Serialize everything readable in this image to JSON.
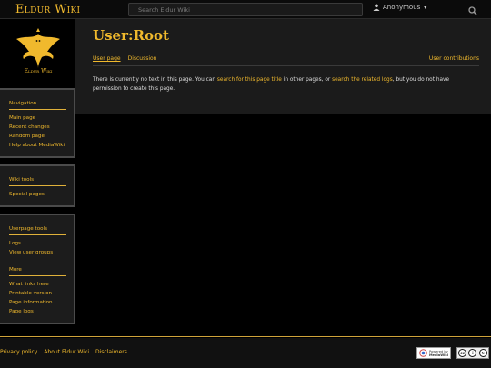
{
  "topbar": {
    "brand": "Eldur Wiki",
    "search_placeholder": "Search Eldur Wiki",
    "user_label": "Anonymous"
  },
  "logo": {
    "text": "Eldur Wiki"
  },
  "sidebar": {
    "navigation": {
      "heading": "Navigation",
      "items": [
        "Main page",
        "Recent changes",
        "Random page",
        "Help about MediaWiki"
      ]
    },
    "wiki_tools": {
      "heading": "Wiki tools",
      "items": [
        "Special pages"
      ]
    },
    "userpage_tools": {
      "heading": "Userpage tools",
      "items": [
        "Logs",
        "View user groups"
      ]
    },
    "more": {
      "heading": "More",
      "items": [
        "What links here",
        "Printable version",
        "Page information",
        "Page logs"
      ]
    }
  },
  "content": {
    "title": "User:Root",
    "tabs_left": [
      "User page",
      "Discussion"
    ],
    "tab_right": "User contributions",
    "notice": {
      "part1": "There is currently no text in this page. You can ",
      "link1": "search for this page title",
      "part2": " in other pages, or ",
      "link2": "search the related logs",
      "part3": ", but you do not have permission to create this page."
    }
  },
  "footer": {
    "links": [
      "Privacy policy",
      "About Eldur Wiki",
      "Disclaimers"
    ],
    "mw_badge_line1": "Powered by",
    "mw_badge_line2": "MediaWiki"
  },
  "colors": {
    "accent": "#f0b92d",
    "background": "#000000",
    "panel": "#1c1c1c"
  }
}
